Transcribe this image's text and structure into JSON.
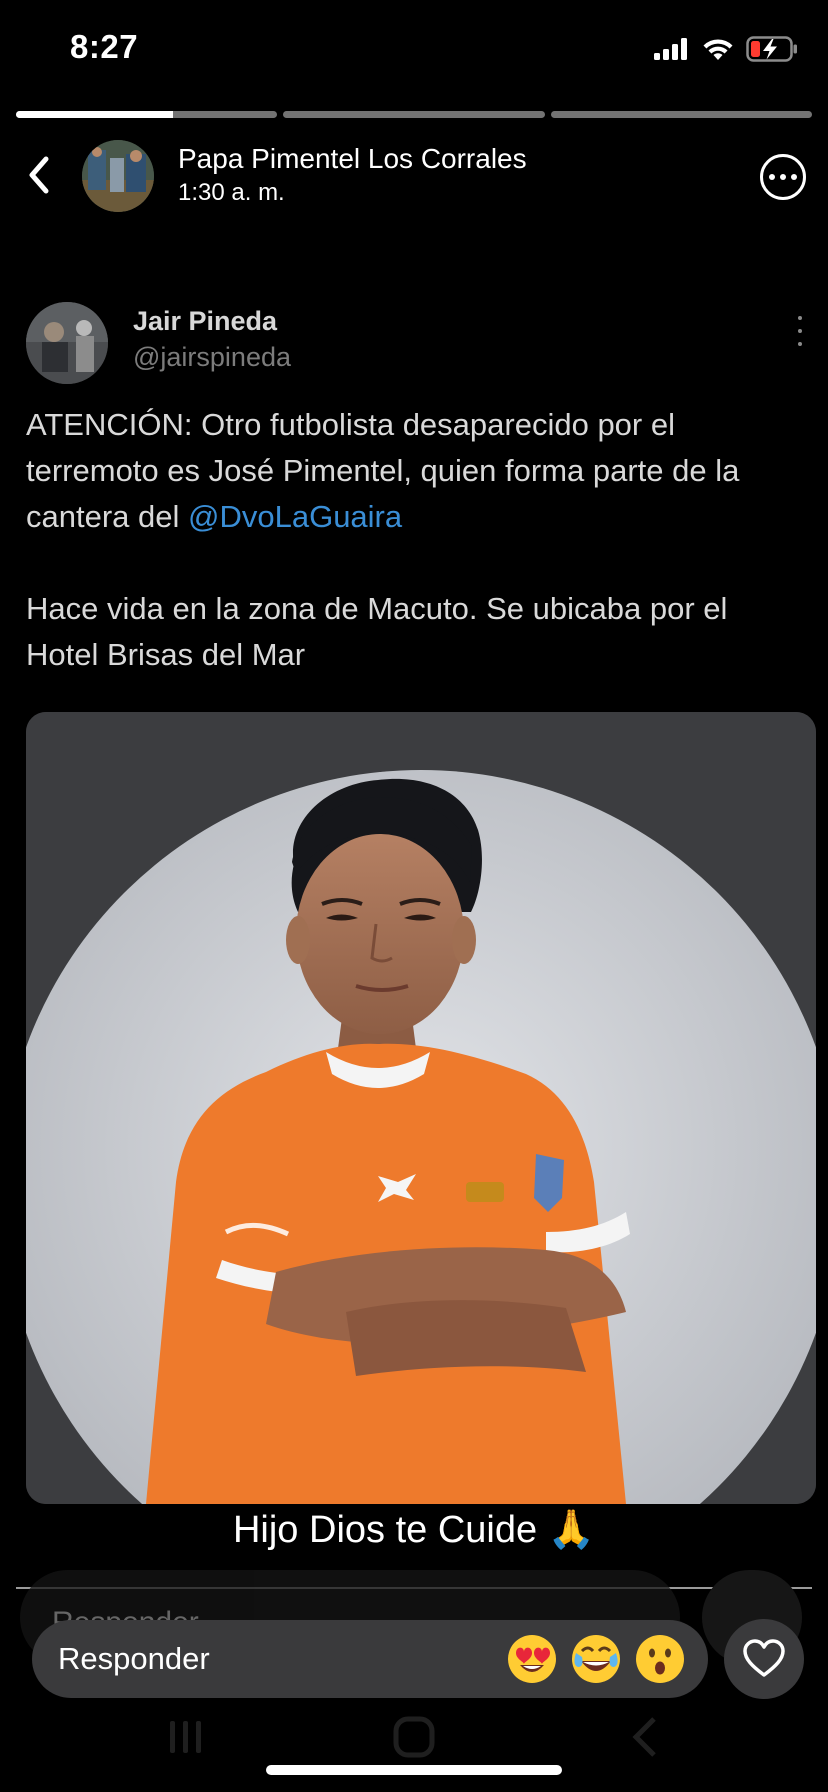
{
  "status_bar": {
    "time": "8:27",
    "icons": [
      "signal-icon",
      "wifi-icon",
      "battery-charging-icon"
    ],
    "battery_color": "#ff3b30"
  },
  "progress": {
    "segments": 3,
    "current_segment_fill": 0.6
  },
  "header": {
    "name": "Papa Pimentel Los Corrales",
    "time": "1:30 a. m."
  },
  "tweet": {
    "author_name": "Jair Pineda",
    "author_handle": "@jairspineda",
    "paragraph1": "ATENCIÓN: Otro futbolista desaparecido por el terremoto es José Pimentel, quien forma parte de la cantera del ",
    "mention": "@DvoLaGuaira",
    "paragraph2": "Hace vida en la zona de Macuto. Se ubicaba por el Hotel Brisas del Mar",
    "mention_color": "#3a8ed6"
  },
  "story": {
    "caption": "Hijo Dios te Cuide 🙏"
  },
  "ghost_reply": {
    "placeholder": "Responder"
  },
  "reply_bar": {
    "placeholder": "Responder",
    "reactions": [
      "heart-eyes-emoji",
      "tears-of-joy-emoji",
      "astonished-emoji"
    ]
  },
  "colors": {
    "background": "#000000",
    "pill": "#3a3a3c",
    "jersey": "#ef7a2b"
  }
}
